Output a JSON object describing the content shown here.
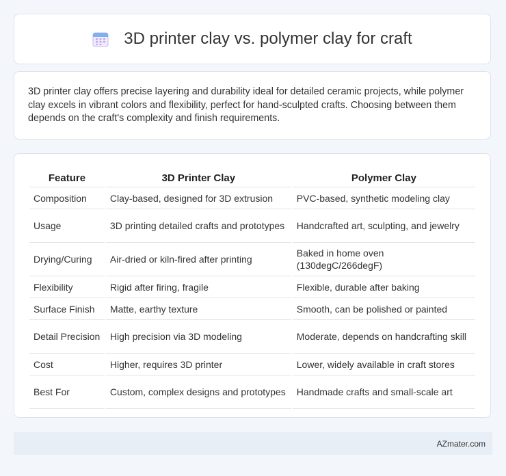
{
  "header": {
    "title": "3D printer clay vs. polymer clay for craft",
    "icon": "calendar-icon"
  },
  "intro": {
    "text": "3D printer clay offers precise layering and durability ideal for detailed ceramic projects, while polymer clay excels in vibrant colors and flexibility, perfect for hand-sculpted crafts. Choosing between them depends on the craft's complexity and finish requirements."
  },
  "table": {
    "headers": [
      "Feature",
      "3D Printer Clay",
      "Polymer Clay"
    ],
    "rows": [
      [
        "Composition",
        "Clay-based, designed for 3D extrusion",
        "PVC-based, synthetic modeling clay"
      ],
      [
        "Usage",
        "3D printing detailed crafts and prototypes",
        "Handcrafted art, sculpting, and jewelry"
      ],
      [
        "Drying/Curing",
        "Air-dried or kiln-fired after printing",
        "Baked in home oven (130degC/266degF)"
      ],
      [
        "Flexibility",
        "Rigid after firing, fragile",
        "Flexible, durable after baking"
      ],
      [
        "Surface Finish",
        "Matte, earthy texture",
        "Smooth, can be polished or painted"
      ],
      [
        "Detail Precision",
        "High precision via 3D modeling",
        "Moderate, depends on handcrafting skill"
      ],
      [
        "Cost",
        "Higher, requires 3D printer",
        "Lower, widely available in craft stores"
      ],
      [
        "Best For",
        "Custom, complex designs and prototypes",
        "Handmade crafts and small-scale art"
      ]
    ]
  },
  "footer": {
    "brand": "AZmater.com"
  }
}
